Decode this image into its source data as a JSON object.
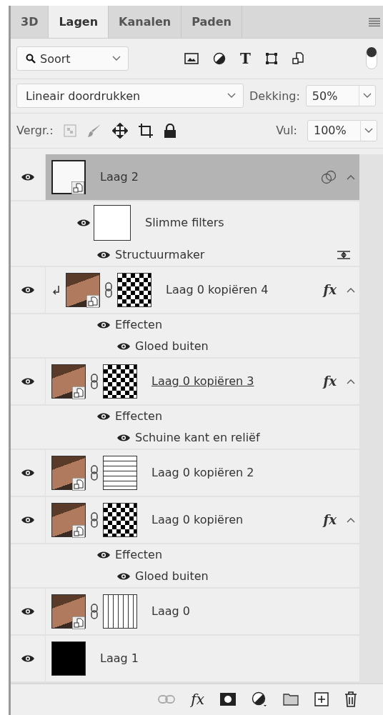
{
  "tabs": [
    {
      "label": "3D",
      "selected": false
    },
    {
      "label": "Lagen",
      "selected": true
    },
    {
      "label": "Kanalen",
      "selected": false
    },
    {
      "label": "Paden",
      "selected": false
    }
  ],
  "filter": {
    "value": "Soort",
    "type_glyph": "T",
    "on": true
  },
  "blend": {
    "mode": "Lineair doordrukken",
    "opacity_label": "Dekking:",
    "opacity": "50%"
  },
  "lock": {
    "label": "Vergr.:",
    "fill_label": "Vul:",
    "fill": "100%"
  },
  "layers": [
    {
      "name": "Laag 2",
      "selected": true,
      "visible": true,
      "thumb": {
        "kind": "smart"
      },
      "clipped": false,
      "renaming": false,
      "blending_options": true,
      "expanded": true,
      "sections": [
        {
          "kind": "smart-filters",
          "label": "Slimme filters",
          "visible": true,
          "items": [
            {
              "label": "Structuurmaker",
              "visible": true
            }
          ]
        }
      ]
    },
    {
      "name": "Laag 0 kopiëren 4",
      "selected": false,
      "visible": true,
      "thumb": {
        "kind": "photo"
      },
      "mask": {
        "kind": "checker"
      },
      "clipped": true,
      "renaming": false,
      "fx": "fx",
      "expanded": true,
      "sections": [
        {
          "kind": "effects",
          "label": "Effecten",
          "visible": true,
          "items": [
            {
              "label": "Gloed buiten",
              "visible": true
            }
          ]
        }
      ]
    },
    {
      "name": "Laag 0 kopiëren 3",
      "selected": false,
      "visible": true,
      "thumb": {
        "kind": "photo"
      },
      "mask": {
        "kind": "checker"
      },
      "clipped": false,
      "renaming": true,
      "fx": "fx",
      "expanded": true,
      "sections": [
        {
          "kind": "effects",
          "label": "Effecten",
          "visible": true,
          "items": [
            {
              "label": "Schuine kant en reliëf",
              "visible": true
            }
          ]
        }
      ]
    },
    {
      "name": "Laag 0 kopiëren 2",
      "selected": false,
      "visible": true,
      "thumb": {
        "kind": "photo"
      },
      "mask": {
        "kind": "hlines"
      },
      "clipped": false,
      "renaming": false,
      "expanded": false
    },
    {
      "name": "Laag 0 kopiëren",
      "selected": false,
      "visible": true,
      "thumb": {
        "kind": "photo"
      },
      "mask": {
        "kind": "checker"
      },
      "clipped": false,
      "renaming": false,
      "fx": "fx",
      "expanded": true,
      "sections": [
        {
          "kind": "effects",
          "label": "Effecten",
          "visible": true,
          "items": [
            {
              "label": "Gloed buiten",
              "visible": true
            }
          ]
        }
      ]
    },
    {
      "name": "Laag 0",
      "selected": false,
      "visible": true,
      "thumb": {
        "kind": "photo"
      },
      "mask": {
        "kind": "vlines"
      },
      "clipped": false,
      "renaming": false,
      "expanded": false
    },
    {
      "name": "Laag 1",
      "selected": false,
      "visible": true,
      "thumb": {
        "kind": "fill"
      },
      "clipped": false,
      "renaming": false,
      "expanded": false
    }
  ],
  "footer": {
    "fx": "fx"
  }
}
